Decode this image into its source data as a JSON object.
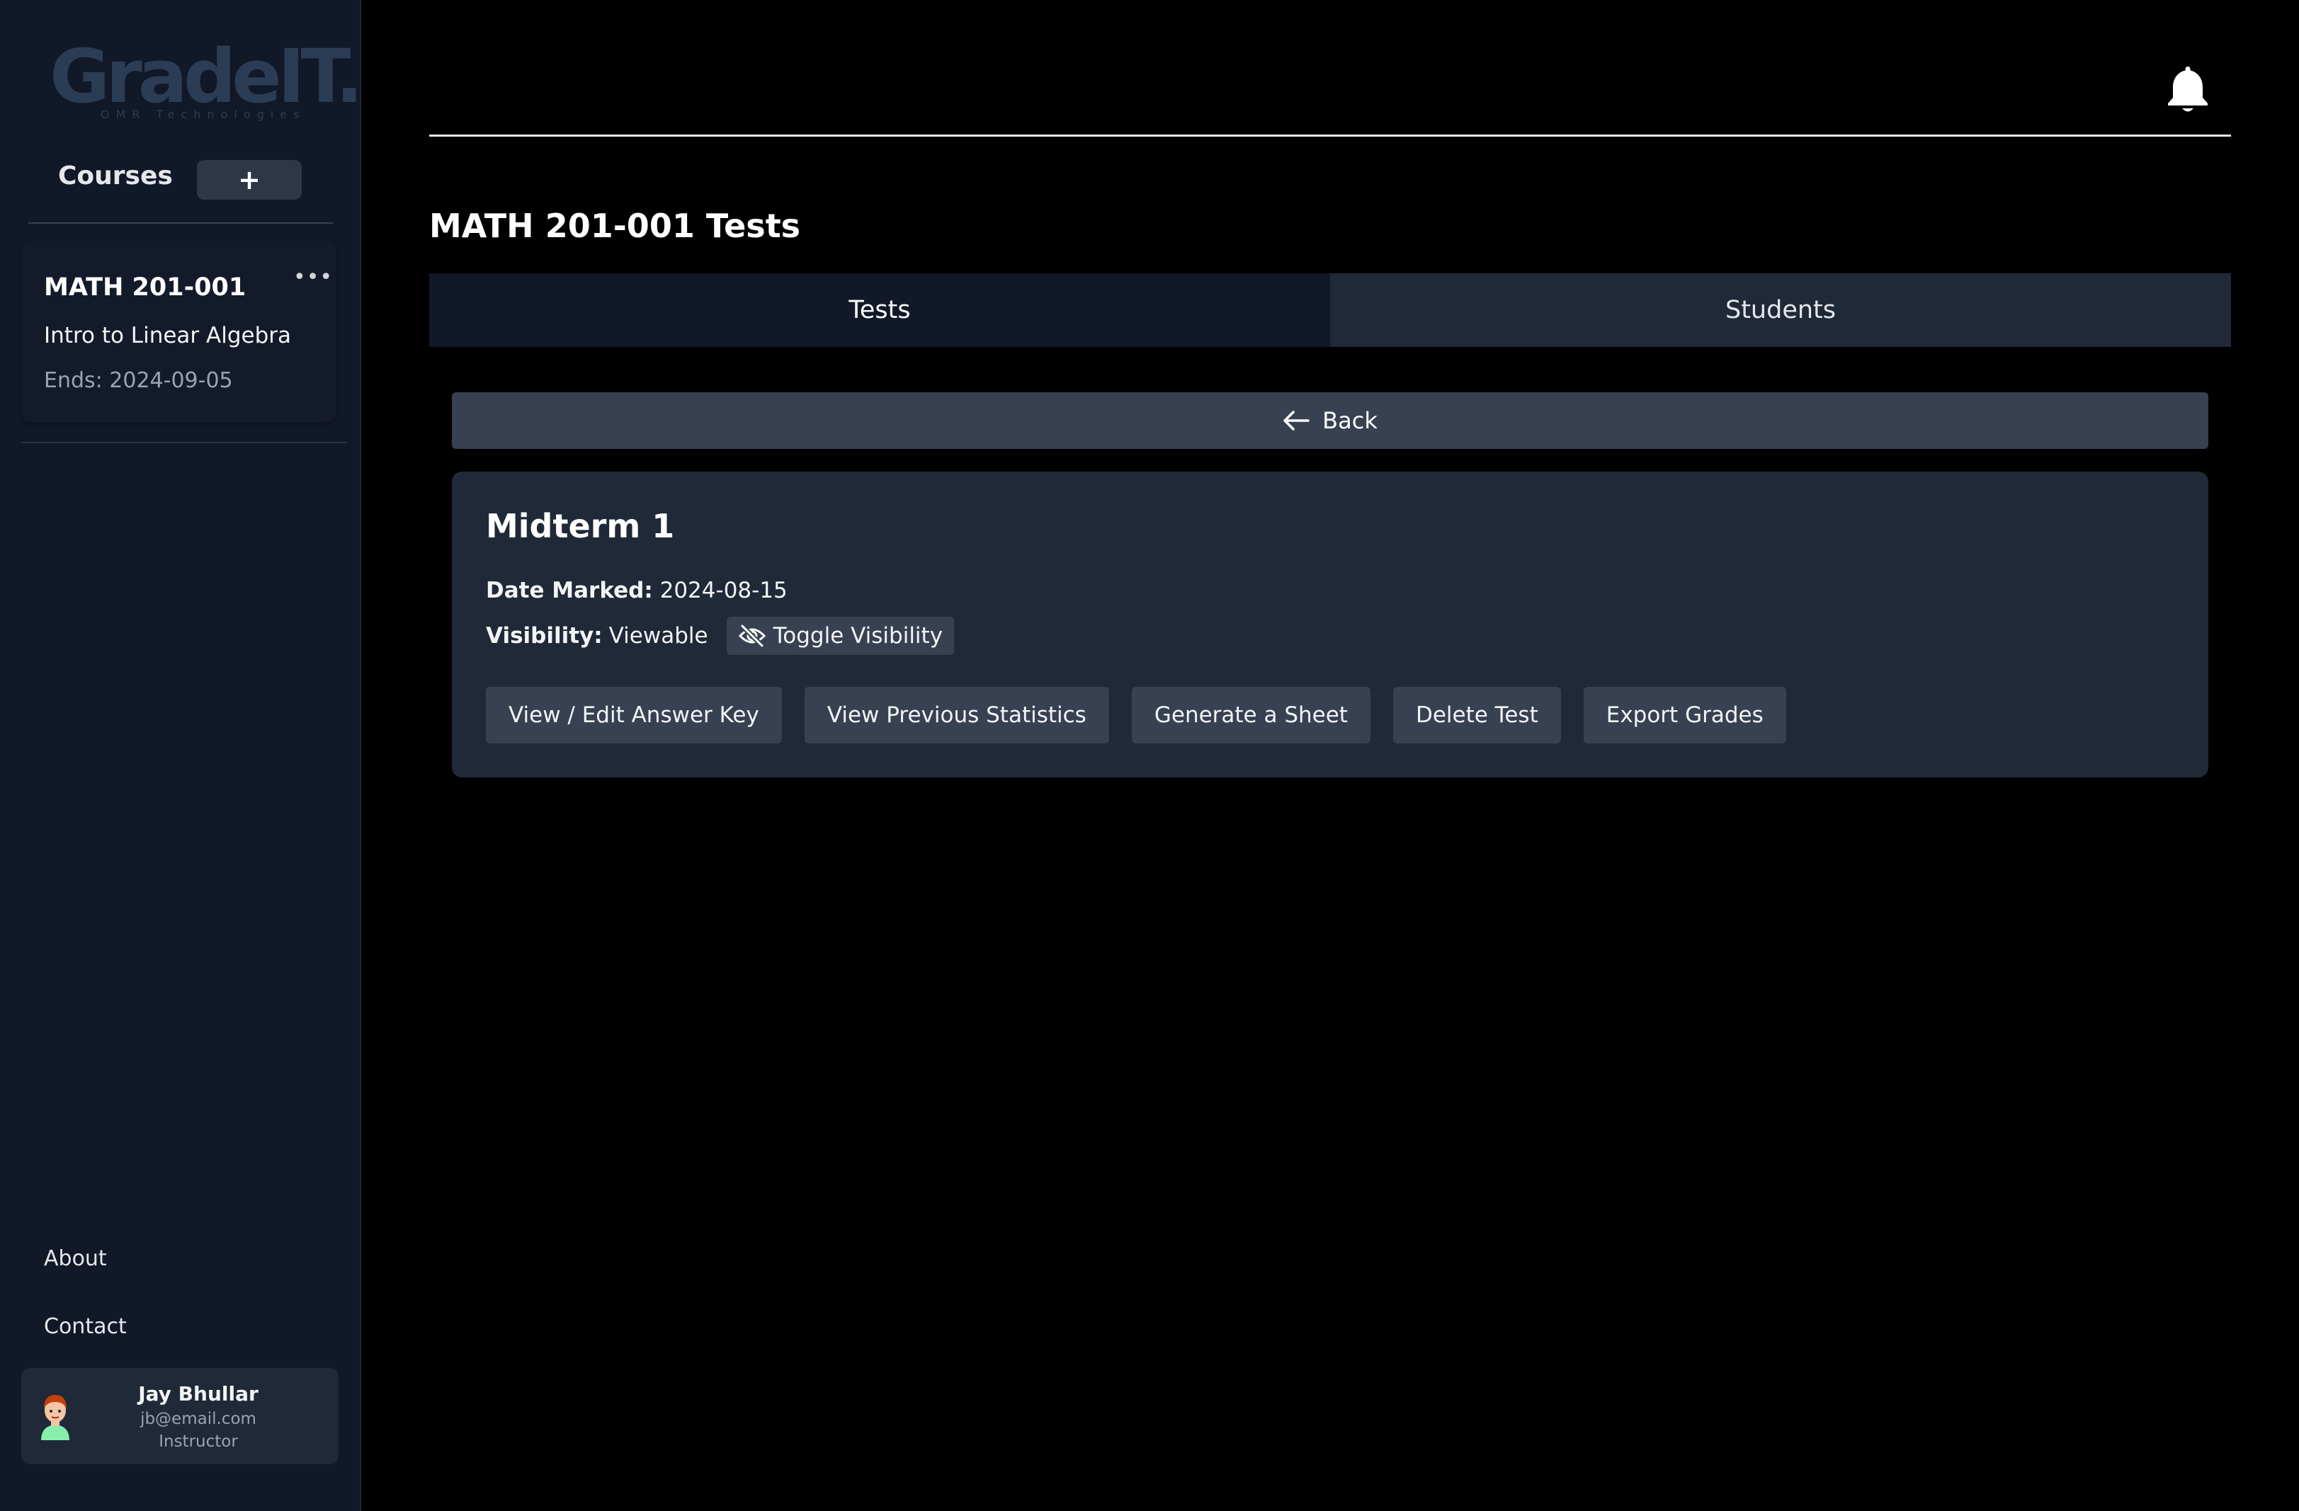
{
  "brand": {
    "logo_text": "GradeIT.",
    "tagline": "OMR Technologies"
  },
  "sidebar": {
    "courses_label": "Courses",
    "add_course_label": "+",
    "courses": [
      {
        "code": "MATH 201-001",
        "name": "Intro to Linear Algebra",
        "ends": "Ends: 2024-09-05",
        "menu_label": "•••"
      }
    ],
    "nav": {
      "about": "About",
      "contact": "Contact"
    },
    "user": {
      "name": "Jay Bhullar",
      "email": "jb@email.com",
      "role": "Instructor"
    }
  },
  "header": {
    "notifications_icon": "bell-icon"
  },
  "main": {
    "title": "MATH 201-001 Tests",
    "tabs": [
      {
        "label": "Tests",
        "active": true
      },
      {
        "label": "Students",
        "active": false
      }
    ],
    "back_label": "Back",
    "test": {
      "title": "Midterm 1",
      "date_marked_label": "Date Marked:",
      "date_marked_value": "2024-08-15",
      "visibility_label": "Visibility:",
      "visibility_value": "Viewable",
      "toggle_visibility_label": "Toggle Visibility",
      "actions": [
        "View / Edit Answer Key",
        "View Previous Statistics",
        "Generate a Sheet",
        "Delete Test",
        "Export Grades"
      ]
    }
  },
  "colors": {
    "background": "#000000",
    "sidebar": "#111827",
    "card": "#1f2937",
    "button": "#374151",
    "logo": "#2b3d55"
  }
}
